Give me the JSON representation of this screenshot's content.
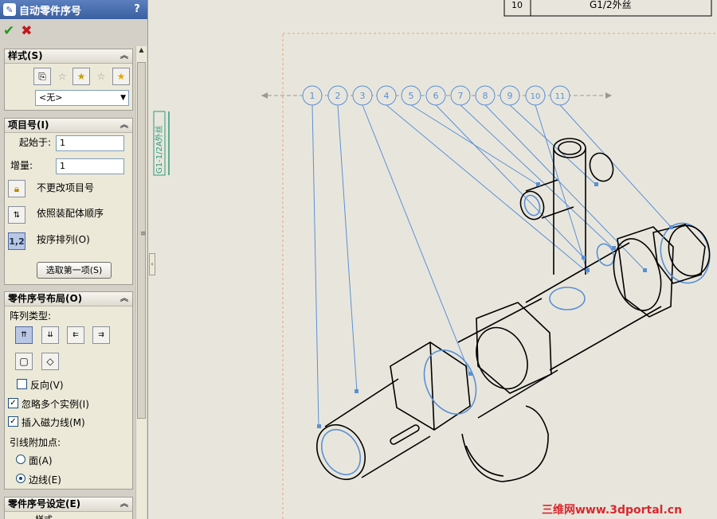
{
  "panel": {
    "title": "自动零件序号",
    "help": "?",
    "ok": "✔",
    "cancel": "✖"
  },
  "style_group": {
    "title": "样式(S)",
    "dropdown_value": "<无>"
  },
  "item_number_group": {
    "title": "项目号(I)",
    "start_label": "起始于:",
    "start_value": "1",
    "increment_label": "增量:",
    "increment_value": "1",
    "option_keep": "不更改项目号",
    "option_assembly_order": "依照装配体顺序",
    "option_sort": "按序排列(O)",
    "select_first_button": "选取第一项(S)"
  },
  "layout_group": {
    "title": "零件序号布局(O)",
    "pattern_label": "阵列类型:",
    "reverse_label": "反向(V)",
    "ignore_multiple_label": "忽略多个实例(I)",
    "insert_magnetic_label": "插入磁力线(M)",
    "attach_label": "引线附加点:",
    "face_label": "面(A)",
    "edge_label": "边线(E)",
    "reverse_checked": false,
    "ignore_multiple_checked": true,
    "insert_magnetic_checked": true,
    "attach_selected": "edge"
  },
  "settings_group": {
    "title": "零件序号设定(E)",
    "sub_label": "样式"
  },
  "drawing": {
    "table_row_num": "10",
    "table_row_text": "G1/2外丝",
    "dimension_text": "G1-1/2A外丝",
    "balloons": [
      "1",
      "2",
      "3",
      "4",
      "5",
      "6",
      "7",
      "8",
      "9",
      "10",
      "11"
    ]
  },
  "watermark": "三维网www.3dportal.cn",
  "colors": {
    "title_bar": "#3a5f9f",
    "leader_blue": "#5b8fd6",
    "sheet_border": "#f0a070"
  }
}
